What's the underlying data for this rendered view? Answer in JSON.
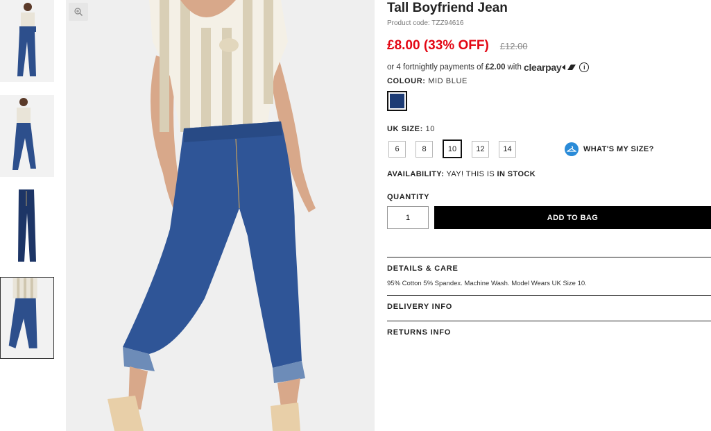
{
  "product": {
    "title": "Tall Boyfriend Jean",
    "code": "Product code: TZZ94616",
    "price": "£8.00 (33% OFF)",
    "old_price": "£12.00"
  },
  "installments": {
    "prefix": "or 4 fortnightly payments of",
    "amount": "£2.00",
    "suffix": "with",
    "provider": "clearpay",
    "info_icon": "i"
  },
  "colour": {
    "label": "COLOUR:",
    "value": "MID BLUE",
    "swatch_color": "#1c3b75"
  },
  "size": {
    "label": "UK SIZE:",
    "value": "10",
    "options": [
      "6",
      "8",
      "10",
      "12",
      "14"
    ],
    "selected": "10",
    "guide_label": "WHAT'S MY SIZE?"
  },
  "availability": {
    "label": "AVAILABILITY:",
    "text": "YAY! THIS IS",
    "status": "IN STOCK"
  },
  "quantity": {
    "label": "QUANTITY",
    "value": "1"
  },
  "add_to_bag": "ADD TO BAG",
  "accordion": {
    "details_title": "DETAILS & CARE",
    "details_body": "95% Cotton 5% Spandex. Machine Wash. Model Wears UK Size 10.",
    "delivery_title": "DELIVERY INFO",
    "returns_title": "RETURNS INFO"
  },
  "icons": {
    "zoom": "zoom-icon",
    "hanger": "hanger-icon",
    "info": "info-icon"
  },
  "colors": {
    "sale_red": "#e30613",
    "button_black": "#000000",
    "accent_blue": "#2a8bd8"
  }
}
